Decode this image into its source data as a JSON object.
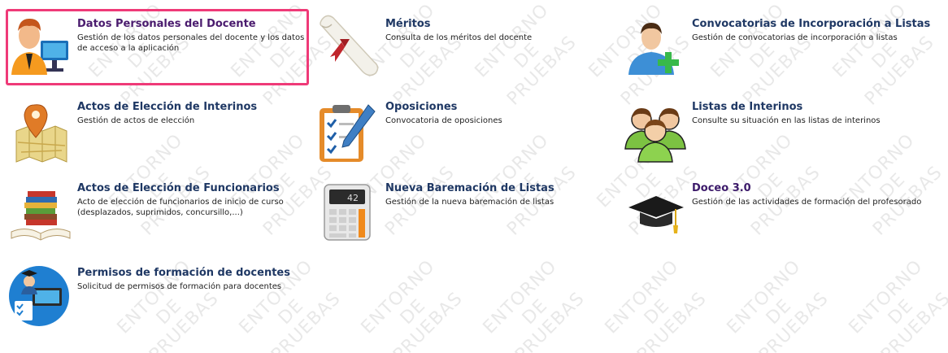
{
  "watermark": {
    "lines": [
      "ENTORNO",
      "DE",
      "PRUEBAS"
    ]
  },
  "tiles": [
    {
      "title": "Datos Personales del Docente",
      "desc": "Gestión de los datos personales del docente y los datos de acceso a la aplicación",
      "icon": "teacher-at-computer-icon",
      "selected": true
    },
    {
      "title": "Méritos",
      "desc": "Consulta de los méritos del docente",
      "icon": "diploma-scroll-icon"
    },
    {
      "title": "Convocatorias de Incorporación a Listas",
      "desc": "Gestión de convocatorias de incorporación a listas",
      "icon": "add-user-icon"
    },
    {
      "title": "Actos de Elección de Interinos",
      "desc": "Gestión de actos de elección",
      "icon": "map-pin-icon"
    },
    {
      "title": "Oposiciones",
      "desc": "Convocatoria de oposiciones",
      "icon": "clipboard-checklist-icon"
    },
    {
      "title": "Listas de Interinos",
      "desc": "Consulte su situación en las listas de interinos",
      "icon": "user-group-icon"
    },
    {
      "title": "Actos de Elección de Funcionarios",
      "desc": "Acto de elección de funcionarios de inicio de curso (desplazados, suprimidos, concursillo,...)",
      "icon": "books-stack-icon"
    },
    {
      "title": "Nueva Baremación de Listas",
      "desc": "Gestión de la nueva baremación de listas",
      "icon": "calculator-icon"
    },
    {
      "title": "Doceo 3.0",
      "desc": "Gestión de las actividades de formación del profesorado",
      "icon": "graduation-cap-icon"
    },
    {
      "title": "Permisos de formación de docentes",
      "desc": "Solicitud de permisos de formación para docentes",
      "icon": "training-permit-icon"
    }
  ],
  "colors": {
    "title": "#1f3864",
    "selected_title": "#4a1b6e",
    "highlight_border": "#ef3a78"
  }
}
